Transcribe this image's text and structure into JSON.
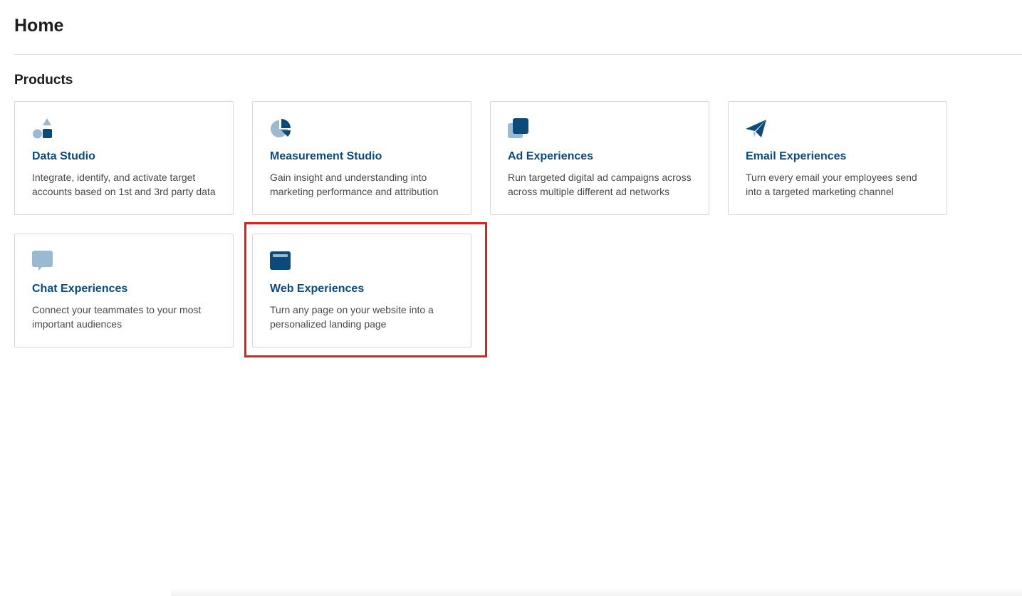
{
  "page": {
    "title": "Home"
  },
  "products_section": {
    "title": "Products",
    "cards": [
      {
        "icon": "shapes-icon",
        "title": "Data Studio",
        "description": "Integrate, identify, and activate target accounts based on 1st and 3rd party data"
      },
      {
        "icon": "pie-chart-icon",
        "title": "Measurement Studio",
        "description": "Gain insight and understanding into marketing performance and attribution"
      },
      {
        "icon": "layered-squares-icon",
        "title": "Ad Experiences",
        "description": "Run targeted digital ad campaigns across across multiple different ad networks"
      },
      {
        "icon": "paper-plane-icon",
        "title": "Email Experiences",
        "description": "Turn every email your employees send into a targeted marketing channel"
      },
      {
        "icon": "chat-bubble-icon",
        "title": "Chat Experiences",
        "description": "Connect your teammates to your most important audiences"
      },
      {
        "icon": "browser-window-icon",
        "title": "Web Experiences",
        "description": "Turn any page on your website into a personalized landing page"
      }
    ]
  },
  "colors": {
    "title_blue": "#0c4a7a",
    "icon_dark": "#0c4a7a",
    "icon_light": "#9bbad2",
    "highlight_red": "#e0201b"
  }
}
